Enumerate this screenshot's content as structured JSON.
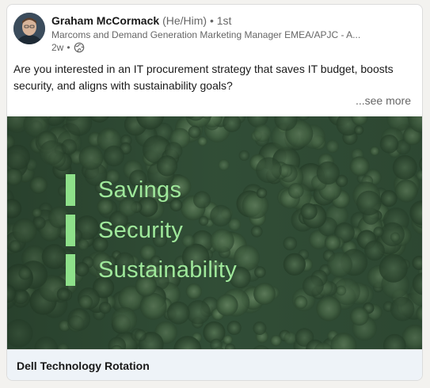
{
  "post": {
    "author": {
      "name": "Graham McCormack",
      "pronouns": "(He/Him)",
      "separator": "•",
      "degree": "1st",
      "headline": "Marcoms and Demand Generation Marketing Manager EMEA/APJC - A...",
      "time": "2w",
      "meta_separator": "•",
      "visibility_icon": "globe-icon"
    },
    "text": "Are you interested in an IT procurement strategy that saves IT budget, boosts security, and aligns with sustainability goals?",
    "see_more": "...see more",
    "media": {
      "words": [
        "Savings",
        "Security",
        "Sustainability"
      ],
      "accent_color": "#8ee08a",
      "background": "aerial forest"
    },
    "footer_title": "Dell Technology Rotation"
  }
}
